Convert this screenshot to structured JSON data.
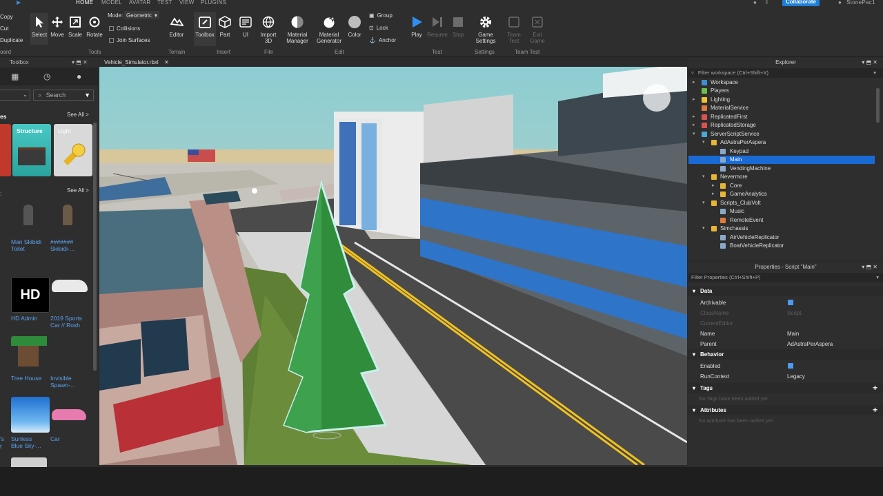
{
  "menu": {
    "tabs": [
      "HOME",
      "MODEL",
      "AVATAR",
      "TEST",
      "VIEW",
      "PLUGINS"
    ],
    "collaborate": "Collaborate",
    "user": "StonePac1"
  },
  "clipboard": {
    "copy": "Copy",
    "cut": "Cut",
    "duplicate": "Duplicate",
    "group": "oard"
  },
  "tools": {
    "select": "Select",
    "move": "Move",
    "scale": "Scale",
    "rotate": "Rotate",
    "mode_label": "Mode:",
    "mode_value": "Geometric",
    "collisions": "Collisions",
    "join": "Join Surfaces",
    "group": "Tools"
  },
  "terrain": {
    "editor": "Editor",
    "group": "Terrain"
  },
  "insert": {
    "toolbox": "Toolbox",
    "part": "Part",
    "ui": "UI",
    "group": "Insert"
  },
  "file": {
    "import3d_1": "Import",
    "import3d_2": "3D",
    "group": "File"
  },
  "edit": {
    "mat_mgr_1": "Material",
    "mat_mgr_2": "Manager",
    "mat_gen_1": "Material",
    "mat_gen_2": "Generator",
    "color": "Color",
    "group_btn": "Group",
    "lock": "Lock",
    "anchor": "Anchor",
    "group": "Edit"
  },
  "test": {
    "play": "Play",
    "resume": "Resume",
    "stop": "Stop",
    "group": "Test"
  },
  "settings": {
    "game_1": "Game",
    "game_2": "Settings",
    "group": "Settings"
  },
  "teamtest": {
    "team_1": "Team",
    "team_2": "Test",
    "exit_1": "Exit",
    "exit_2": "Game",
    "group": "Team Test"
  },
  "toolbox": {
    "title": "Toolbox",
    "search_placeholder": "Search",
    "section1": "es",
    "see_all": "See All >",
    "see_all2": "See All >",
    "cat_structure": "Structure",
    "cat_light": "Light",
    "items": [
      {
        "l1": "Man Skibidi",
        "l2": "Toilet"
      },
      {
        "l1": "#######",
        "l2": "Skibidi-..."
      },
      {
        "l1": "HD Admin",
        "l2": ""
      },
      {
        "l1": "2019 Sports",
        "l2": "Car // Rosh"
      },
      {
        "l1": "Tree House",
        "l2": ""
      },
      {
        "l1": "Invisible",
        "l2": "Spawn-..."
      },
      {
        "l1": "Sunless",
        "l2": "Blue Sky-..."
      },
      {
        "l1": "Car",
        "l2": ""
      }
    ],
    "hd_text": "HD",
    "edge1": "'s",
    "edge2": "t"
  },
  "doctab": {
    "name": "Vehicle_Simulator.rbxl"
  },
  "explorer": {
    "title": "Explorer",
    "filter": "Filter workspace (Ctrl+Shift+X)",
    "rows": [
      {
        "label": "Workspace",
        "icon": "#3d8fd8"
      },
      {
        "label": "Players",
        "icon": "#6fbf4a"
      },
      {
        "label": "Lighting",
        "icon": "#f0c430"
      },
      {
        "label": "MaterialService",
        "icon": "#e07a3c"
      },
      {
        "label": "ReplicatedFirst",
        "icon": "#d9534f"
      },
      {
        "label": "ReplicatedStorage",
        "icon": "#d9534f"
      },
      {
        "label": "ServerScriptService",
        "icon": "#4aa8d8"
      },
      {
        "label": "AdAstraPerAspera",
        "icon": "#e8b437"
      },
      {
        "label": "Keypad",
        "icon": "#8aa8c8"
      },
      {
        "label": "Main",
        "icon": "#8aa8c8"
      },
      {
        "label": "VendingMachine",
        "icon": "#8aa8c8"
      },
      {
        "label": "Nevermore",
        "icon": "#e8b437"
      },
      {
        "label": "Core",
        "icon": "#e8b437"
      },
      {
        "label": "GameAnalytics",
        "icon": "#e8b437"
      },
      {
        "label": "Scripts_ClubVolt",
        "icon": "#e8b437"
      },
      {
        "label": "Music",
        "icon": "#8aa8c8"
      },
      {
        "label": "RemoteEvent",
        "icon": "#e07a3c"
      },
      {
        "label": "Simchassis",
        "icon": "#e8b437"
      },
      {
        "label": "AirVehicleReplicator",
        "icon": "#8aa8c8"
      },
      {
        "label": "BoatVehicleReplicator",
        "icon": "#8aa8c8"
      }
    ]
  },
  "properties": {
    "title": "Properties - Script \"Main\"",
    "filter": "Filter Properties (Ctrl+Shift+P)",
    "data_section": "Data",
    "archivable": "Archivable",
    "classname": "ClassName",
    "classname_val": "Script",
    "currenteditor": "CurrentEditor",
    "name": "Name",
    "name_val": "Main",
    "parent": "Parent",
    "parent_val": "AdAstraPerAspera",
    "behavior_section": "Behavior",
    "enabled": "Enabled",
    "runcontext": "RunContext",
    "runcontext_val": "Legacy",
    "tags_section": "Tags",
    "tags_empty": "No Tags have been added yet",
    "attr_section": "Attributes",
    "attr_empty": "No Attribute has been added yet"
  }
}
